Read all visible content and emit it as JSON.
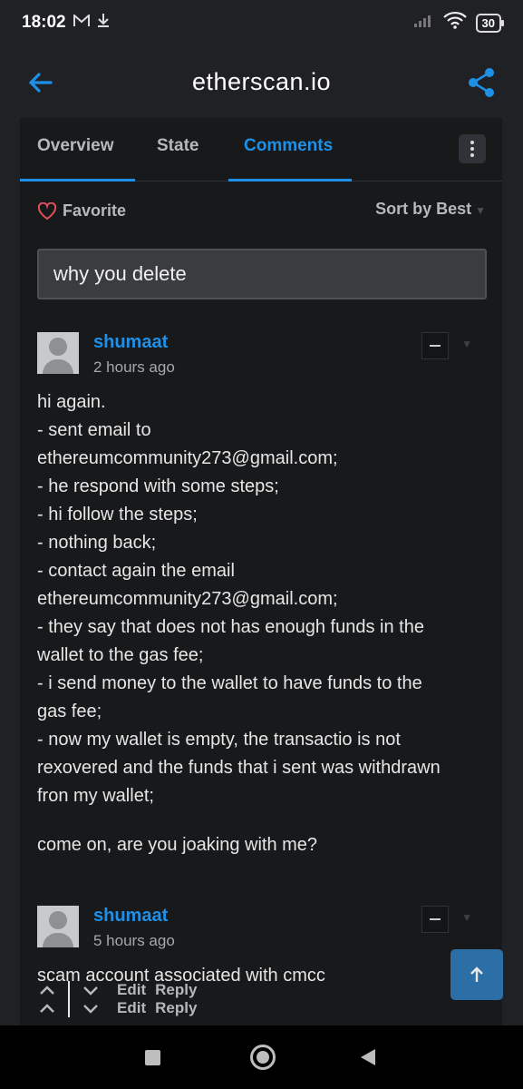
{
  "status": {
    "time": "18:02",
    "battery": "30"
  },
  "appbar": {
    "title": "etherscan.io"
  },
  "tabs": [
    {
      "label": "Overview"
    },
    {
      "label": "State"
    },
    {
      "label": "Comments"
    }
  ],
  "favorite_label": "Favorite",
  "sort_label": "Sort by Best",
  "comment_input": {
    "value": "why you delete"
  },
  "comments": [
    {
      "user": "shumaat",
      "time": "2 hours ago",
      "lines": [
        "hi again.",
        "- sent email to",
        "ethereumcommunity273@gmail.com;",
        "- he respond with some steps;",
        "- hi follow the steps;",
        "- nothing back;",
        "- contact again the email",
        "ethereumcommunity273@gmail.com;",
        "- they say that does not has enough funds in the",
        "wallet to the gas fee;",
        "- i send money to the wallet to have funds to the",
        "gas fee;",
        "- now my wallet is empty, the transactio is not",
        "rexovered and the funds that i sent was withdrawn",
        "fron my wallet;"
      ],
      "closing": "come on, are you joaking with me?",
      "edit": "Edit",
      "reply": "Reply"
    },
    {
      "user": "shumaat",
      "time": "5 hours ago",
      "lines": [
        "scam account associated with cmcc"
      ],
      "edit": "Edit",
      "reply": "Reply"
    }
  ],
  "colors": {
    "accent": "#1e90e8",
    "background": "#202124",
    "card": "#18191b"
  }
}
